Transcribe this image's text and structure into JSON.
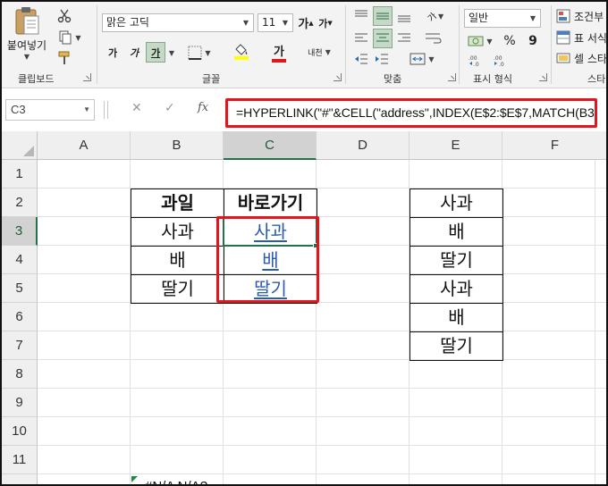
{
  "ribbon": {
    "clipboard": {
      "paste_label": "붙여넣기",
      "group_label": "클립보드",
      "paste_dropdown": "chevron-down-icon"
    },
    "font": {
      "font_name": "맑은 고딕",
      "font_size": "11",
      "grow_label": "가",
      "shrink_label": "가",
      "bold_label": "가",
      "italic_label": "가",
      "underline_label": "가",
      "phonetic_label": "내천",
      "font_color_label": "가",
      "group_label": "글꼴",
      "font_color": "#e0161f",
      "highlight_color": "#ffff00"
    },
    "alignment": {
      "group_label": "맞춤",
      "orientation_label": "가"
    },
    "number": {
      "format": "일반",
      "group_label": "표시 형식",
      "percent": "%",
      "comma": "9"
    },
    "styles": {
      "conditional_label": "조건부",
      "table_label": "표 서식",
      "cell_label": "셀 스타",
      "group_label": "스타"
    }
  },
  "formula_bar": {
    "name_box": "C3",
    "fx_label": "fx",
    "formula": "=HYPERLINK(\"#\"&CELL(\"address\",INDEX(E$2:$E$7,MATCH(B3,"
  },
  "sheet": {
    "columns": [
      "A",
      "B",
      "C",
      "D",
      "E",
      "F"
    ],
    "selected_column": "C",
    "rows": [
      "1",
      "2",
      "3",
      "4",
      "5",
      "6",
      "7",
      "8",
      "9",
      "10",
      "11"
    ],
    "selected_row": "3",
    "table1": {
      "header_b": "과일",
      "header_c": "바로가기",
      "fruits": [
        "사과",
        "배",
        "딸기"
      ],
      "links": [
        "사과",
        "배",
        "딸기"
      ]
    },
    "table2": {
      "values": [
        "사과",
        "배",
        "딸기",
        "사과",
        "배",
        "딸기"
      ]
    },
    "row12_text": "#N/A N/A?"
  },
  "colors": {
    "accent_green": "#217346",
    "highlight_red": "#e0161f",
    "link_blue": "#2b5cb3"
  }
}
